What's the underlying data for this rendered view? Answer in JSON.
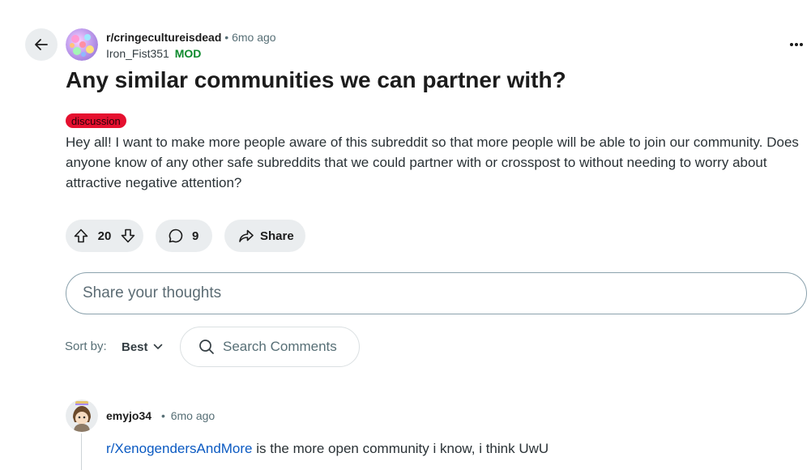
{
  "colors": {
    "flair_bg": "#e5102f",
    "mod_green": "#0d8a2d",
    "link_blue": "#0b5ac2",
    "pill_bg": "#eaedef"
  },
  "icons": {
    "back": "arrow-left-icon",
    "more": "more-horizontal-icon",
    "upvote": "arrow-up-icon",
    "downvote": "arrow-down-icon",
    "comment": "speech-bubble-icon",
    "share": "share-arrow-icon",
    "sort": "chevron-down-icon",
    "search": "search-icon"
  },
  "post": {
    "subreddit": "r/cringecultureisdead",
    "separator": "•",
    "time": "6mo ago",
    "author": "Iron_Fist351",
    "author_badge": "MOD",
    "title": "Any similar communities we can partner with?",
    "flair": "discussion",
    "body": "Hey all! I want to make more people aware of this subreddit so that more people will be able to join our community. Does anyone know of any other safe subreddits that we could partner with or crosspost to without needing to worry about attractive negative attention?",
    "score": "20",
    "comment_count": "9",
    "share_label": "Share"
  },
  "comment_box": {
    "placeholder": "Share your thoughts"
  },
  "sort": {
    "label": "Sort by:",
    "value": "Best"
  },
  "search_comments": {
    "placeholder": "Search Comments"
  },
  "comments": [
    {
      "author": "emyjo34",
      "separator": "•",
      "time": "6mo ago",
      "link_text": "r/XenogendersAndMore",
      "text": " is the more open community i know, i think UwU"
    }
  ]
}
